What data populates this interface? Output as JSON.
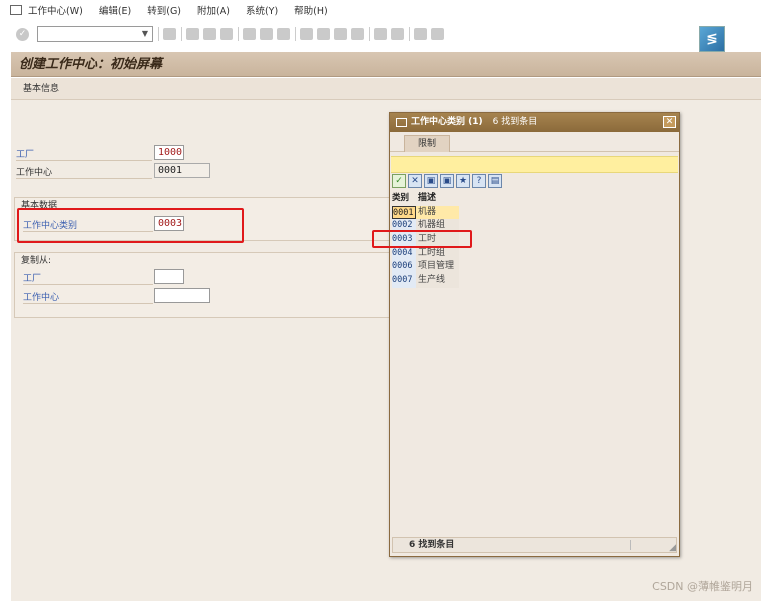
{
  "menu": [
    "工作中心(W)",
    "编辑(E)",
    "转到(G)",
    "附加(A)",
    "系统(Y)",
    "帮助(H)"
  ],
  "title": "创建工作中心：初始屏幕",
  "app_toolbar": "基本信息",
  "form": {
    "plant_label": "工厂",
    "plant_value": "1000",
    "wc_label": "工作中心",
    "wc_value": "0001",
    "basic_group": "基本数据",
    "category_label": "工作中心类别",
    "category_value": "0003",
    "copy_group": "复制从:",
    "copy_plant_label": "工厂",
    "copy_wc_label": "工作中心"
  },
  "popup": {
    "title": "工作中心类别 (1)",
    "found": "6 找到条目",
    "tab": "限制",
    "col_code": "类别",
    "col_desc": "描述",
    "rows": [
      {
        "code": "0001",
        "desc": "机器"
      },
      {
        "code": "0002",
        "desc": "机器组"
      },
      {
        "code": "0003",
        "desc": "工时"
      },
      {
        "code": "0004",
        "desc": "工时组"
      },
      {
        "code": "0006",
        "desc": "项目管理"
      },
      {
        "code": "0007",
        "desc": "生产线"
      }
    ],
    "status": "6 找到条目"
  },
  "watermark": "CSDN @薄帷鉴明月",
  "colors": {
    "highlight": "#e0191b",
    "popup_title": "#8b6a3a"
  }
}
